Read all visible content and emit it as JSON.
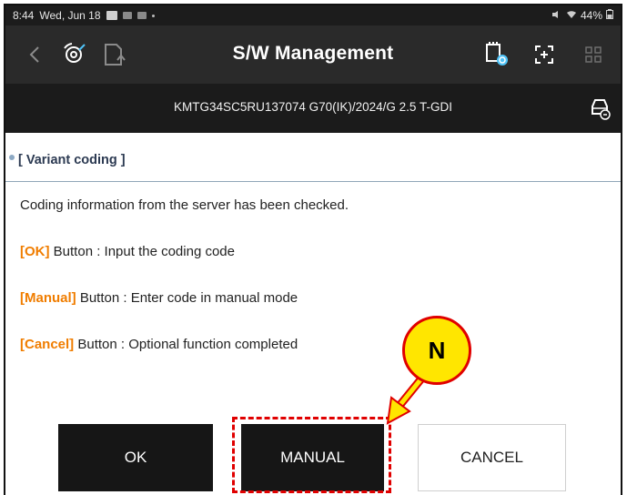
{
  "status_bar": {
    "time": "8:44",
    "date": "Wed, Jun 18",
    "battery": "44%"
  },
  "header": {
    "title": "S/W Management"
  },
  "vehicle": {
    "info": "KMTG34SC5RU137074  G70(IK)/2024/G 2.5 T-GDI"
  },
  "section": {
    "title": "[ Variant coding ]",
    "message": "Coding information from the server has been checked.",
    "lines": [
      {
        "keyword": "[OK]",
        "text": " Button : Input the coding code"
      },
      {
        "keyword": "[Manual]",
        "text": " Button : Enter code in manual mode"
      },
      {
        "keyword": "[Cancel]",
        "text": " Button : Optional function completed"
      }
    ]
  },
  "buttons": {
    "ok": "OK",
    "manual": "MANUAL",
    "cancel": "CANCEL"
  },
  "callout": {
    "label": "N"
  },
  "colors": {
    "keyword": "#f07d00",
    "highlight": "#e00000",
    "callout_fill": "#ffe600"
  }
}
